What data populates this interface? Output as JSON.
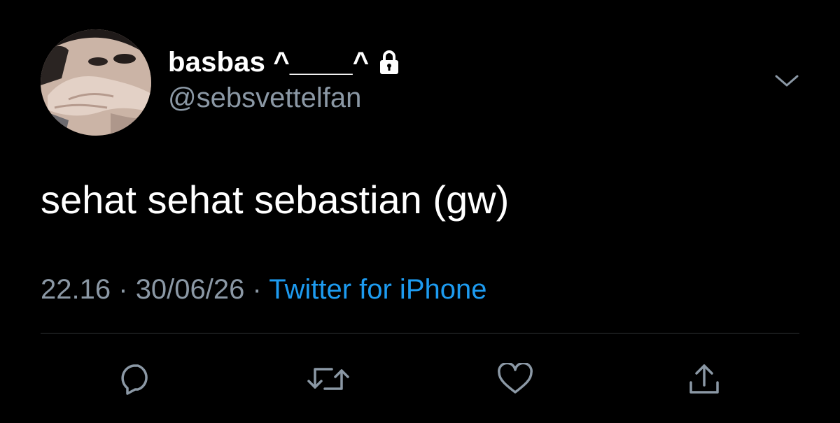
{
  "tweet": {
    "display_name": "basbas ^____^",
    "handle": "@sebsvettelfan",
    "text": "sehat sehat sebastian (gw)",
    "time": "22.16",
    "date": "30/06/26",
    "separator": "·",
    "source": "Twitter for iPhone",
    "protected_icon": "lock-icon"
  },
  "colors": {
    "background": "#000000",
    "primary_text": "#ffffff",
    "secondary_text": "#8b98a5",
    "link": "#1d9bf0",
    "divider": "#2f3336"
  },
  "actions": [
    {
      "name": "reply",
      "icon": "reply-icon"
    },
    {
      "name": "retweet",
      "icon": "retweet-icon"
    },
    {
      "name": "like",
      "icon": "heart-icon"
    },
    {
      "name": "share",
      "icon": "share-icon"
    }
  ]
}
